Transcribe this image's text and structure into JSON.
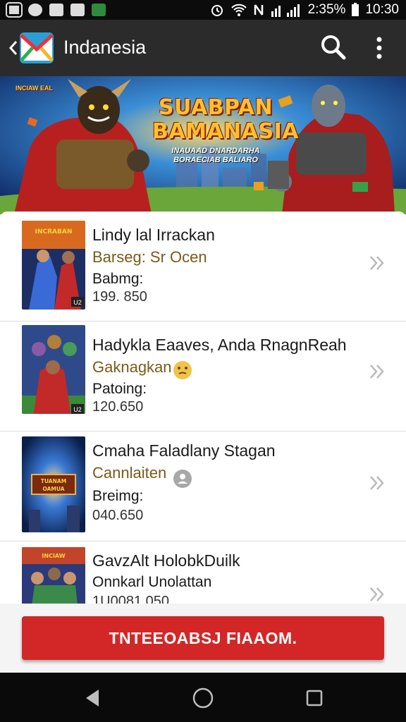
{
  "status_bar": {
    "battery_text": "2:35%",
    "time": "10:30"
  },
  "app_bar": {
    "title": "Indanesia"
  },
  "banner": {
    "corner_text": "INCIAW EAL",
    "title_line1": "SUABPAN",
    "title_line2": "BAMANASIA",
    "subtitle_line1": "INAUAAD DNARDARHA",
    "subtitle_line2": "BORAECIAB BALIARO"
  },
  "items": [
    {
      "title": "Lindy lal Irrackan",
      "tag": "Barseg: Sr Ocen",
      "label": "Babmg:",
      "value": "199. 850",
      "thumb_badge": "U2"
    },
    {
      "title": "Hadykla Eaaves, Anda RnagnReah",
      "tag": "Gaknagkan",
      "label": "Patoing:",
      "value": "120.650",
      "thumb_badge": "U2"
    },
    {
      "title": "Cmaha Faladlany Stagan",
      "tag": "Cannlaiten",
      "label": "Breimg:",
      "value": "040.650",
      "thumb_text": "TUANAM OAMUA"
    },
    {
      "title": "GavzAlt HolobkDuilk",
      "tag": "Onnkarl Unolattan",
      "value": "1U0081.050"
    }
  ],
  "cta": {
    "label": "TNTEEOABSJ FIAAOM."
  },
  "colors": {
    "app_bar": "#2b2b2b",
    "accent_red": "#d32727",
    "tag_brown": "#7a5a1a"
  }
}
